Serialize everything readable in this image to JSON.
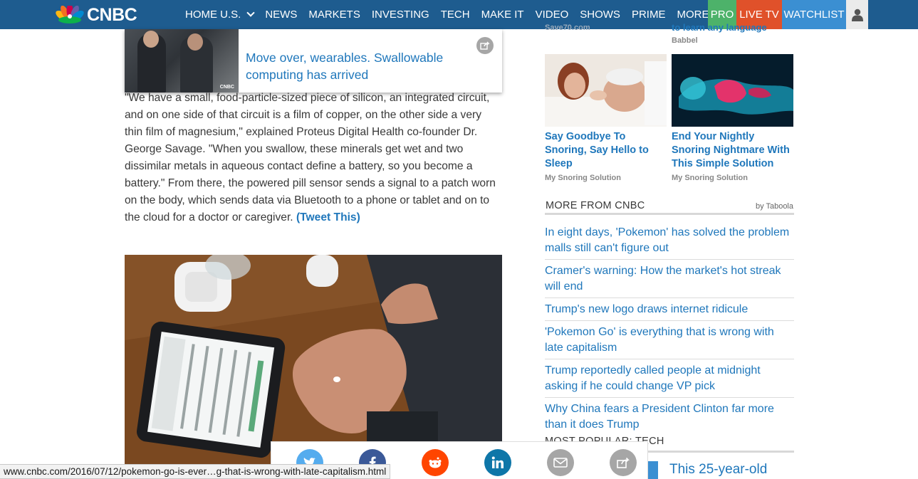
{
  "nav": {
    "logo_text": "CNBC",
    "items": [
      {
        "label": "HOME U.S."
      },
      {
        "label": "NEWS"
      },
      {
        "label": "MARKETS"
      },
      {
        "label": "INVESTING"
      },
      {
        "label": "TECH"
      },
      {
        "label": "MAKE IT"
      },
      {
        "label": "VIDEO"
      },
      {
        "label": "SHOWS"
      },
      {
        "label": "PRIME"
      },
      {
        "label": "MORE"
      }
    ],
    "pro_label": "PRO",
    "live_label": "LIVE TV",
    "watchlist_label": "WATCHLIST",
    "colors": {
      "bar": "#1e5c8f",
      "pro": "#4db26a",
      "live": "#e0512a",
      "watchlist": "#3b8fd2"
    }
  },
  "sticky_video": {
    "title": "Move over, wearables. Swallowable computing has arrived",
    "thumb_tag": "CNBC"
  },
  "article": {
    "paragraph": "\"We have a small, food-particle-sized piece of silicon, an integrated circuit, and on one side of that circuit is a film of copper, on the other side a very thin film of magnesium,\" explained Proteus Digital Health co-founder Dr. George Savage. \"When you swallow, these minerals get wet and two dissimilar metals in aqueous contact define a battery, so you become a battery.\" From there, the powered pill sensor sends a signal to a patch worn on the body, which sends data via Bluetooth to a phone or tablet and on to the cloud for a doctor or caregiver.",
    "tweet_link": "(Tweet This)"
  },
  "promos": {
    "top_left_partial": "Save70.com",
    "top_right_partial": "to learn any language",
    "top_right_source": "Babbel",
    "items": [
      {
        "title": "Say Goodbye To Snoring, Say Hello to Sleep",
        "source": "My Snoring Solution"
      },
      {
        "title": "End Your Nightly Snoring Nightmare With This Simple Solution",
        "source": "My Snoring Solution"
      }
    ]
  },
  "more_from": {
    "heading": "MORE FROM CNBC",
    "provider": "by Taboola",
    "links": [
      "In eight days, 'Pokemon' has solved the problem malls still can't figure out",
      "Cramer's warning: How the market's hot streak will end",
      "Trump's new logo draws internet ridicule",
      "'Pokemon Go' is everything that is wrong with late capitalism",
      "Trump reportedly called people at midnight asking if he could change VP pick",
      "Why China fears a President Clinton far more than it does Trump"
    ]
  },
  "popular": {
    "heading": "MOST POPULAR: TECH",
    "first_headline": "This 25-year-old"
  },
  "share_bar": {
    "buttons": [
      {
        "name": "twitter",
        "color": "#55acee"
      },
      {
        "name": "facebook",
        "color": "#3b5998"
      },
      {
        "name": "reddit",
        "color": "#ff4500"
      },
      {
        "name": "linkedin",
        "color": "#0e76a8"
      },
      {
        "name": "email",
        "color": "#a6a6a6"
      },
      {
        "name": "share",
        "color": "#a6a6a6"
      }
    ]
  },
  "status_bar": {
    "url": "www.cnbc.com/2016/07/12/pokemon-go-is-ever…g-that-is-wrong-with-late-capitalism.html"
  }
}
